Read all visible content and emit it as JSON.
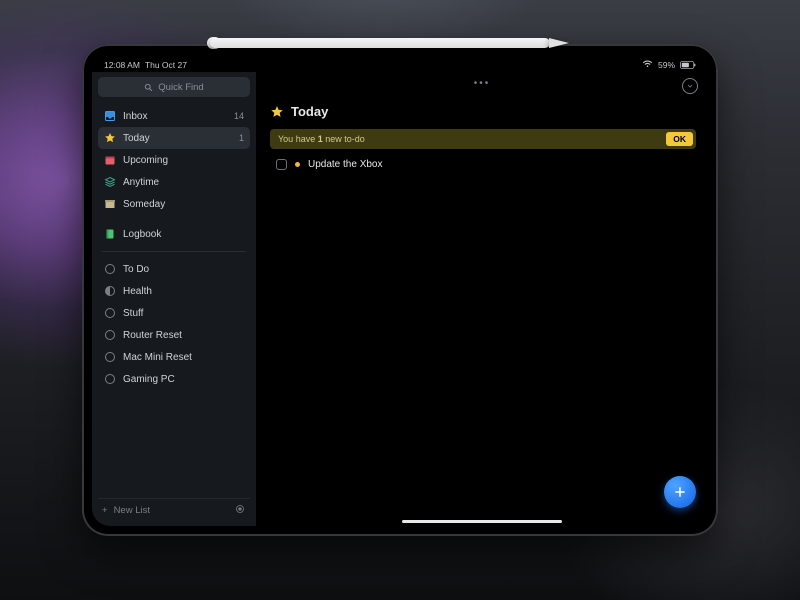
{
  "status": {
    "time": "12:08 AM",
    "date": "Thu Oct 27",
    "battery": "59%"
  },
  "search": {
    "placeholder": "Quick Find"
  },
  "sidebar": {
    "primary": [
      {
        "label": "Inbox",
        "count": "14",
        "color": "#3b9df0",
        "icon": "tray"
      },
      {
        "label": "Today",
        "count": "1",
        "color": "#f4c838",
        "icon": "star",
        "selected": true
      },
      {
        "label": "Upcoming",
        "color": "#e85d6b",
        "icon": "calendar"
      },
      {
        "label": "Anytime",
        "color": "#3aa389",
        "icon": "layers"
      },
      {
        "label": "Someday",
        "color": "#c7b88f",
        "icon": "archive"
      }
    ],
    "logbook": {
      "label": "Logbook",
      "color": "#4cc46e",
      "icon": "book"
    },
    "lists": [
      {
        "label": "To Do"
      },
      {
        "label": "Health",
        "icon": "half"
      },
      {
        "label": "Stuff"
      },
      {
        "label": "Router Reset"
      },
      {
        "label": "Mac Mini Reset"
      },
      {
        "label": "Gaming PC"
      }
    ],
    "newList": "New List"
  },
  "main": {
    "title": "Today",
    "banner": {
      "prefix": "You have ",
      "count": "1",
      "suffix": " new to-do",
      "ok": "OK"
    },
    "todos": [
      {
        "title": "Update the Xbox"
      }
    ]
  }
}
